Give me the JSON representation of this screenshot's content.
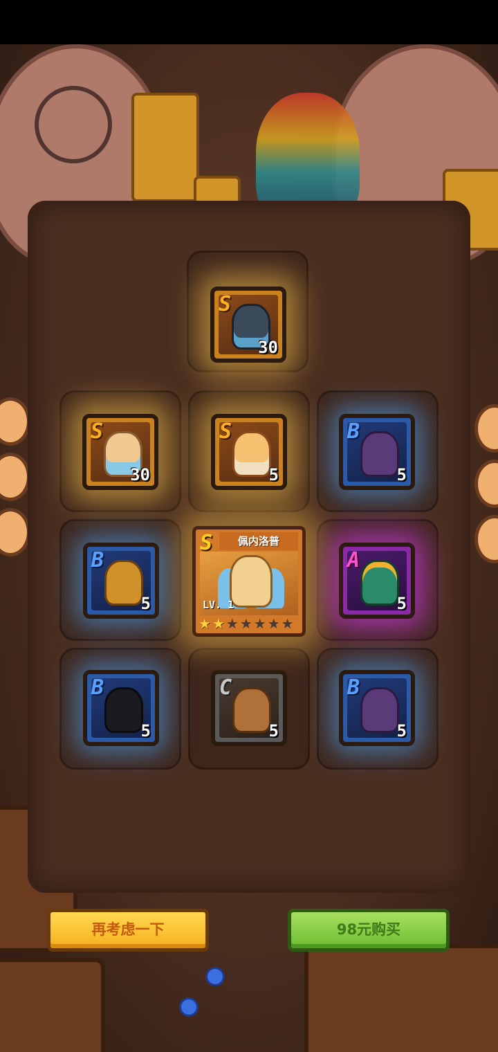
{
  "colors": {
    "tier_s": "#c9821e",
    "tier_a": "#8a2aa8",
    "tier_b": "#2a5aa8",
    "tier_c": "#5a5a5a",
    "button_confirm": "#6cbc30",
    "button_cancel": "#f5b01e"
  },
  "cards": [
    {
      "grade": "S",
      "count": "30",
      "icon": "dark-knight-hero-icon"
    },
    {
      "grade": "S",
      "count": "30",
      "icon": "angel-hero-icon"
    },
    {
      "grade": "S",
      "count": "5",
      "icon": "priestess-hero-icon"
    },
    {
      "grade": "B",
      "count": "5",
      "icon": "shadow-mage-hero-icon"
    },
    {
      "grade": "B",
      "count": "5",
      "icon": "golden-knight-hero-icon"
    },
    {
      "grade": "A",
      "count": "5",
      "icon": "jade-golem-hero-icon"
    },
    {
      "grade": "B",
      "count": "5",
      "icon": "hooded-rogue-hero-icon"
    },
    {
      "grade": "C",
      "count": "5",
      "icon": "peasant-hero-icon"
    },
    {
      "grade": "B",
      "count": "5",
      "icon": "shadow-mage-hero-icon"
    }
  ],
  "featured": {
    "grade": "S",
    "name": "佩内洛普",
    "level": "LV. 1",
    "stars_filled": 2,
    "stars_total": 7
  },
  "buttons": {
    "reconsider": "再考虑一下",
    "buy": "98元购买"
  }
}
